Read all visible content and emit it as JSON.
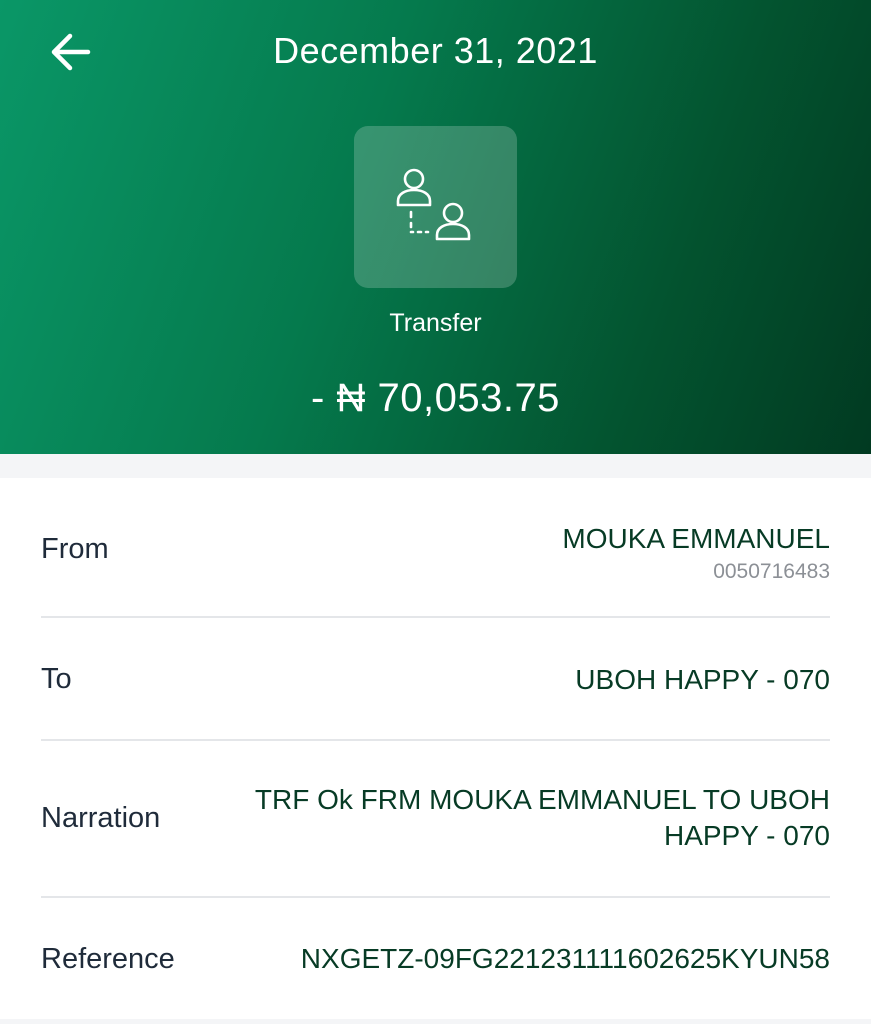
{
  "header": {
    "back_icon": "arrow-left-icon",
    "title": "December 31, 2021",
    "transaction_icon": "transfer-users-icon",
    "type_label": "Transfer",
    "amount": "- ₦ 70,053.75"
  },
  "details": {
    "from": {
      "label": "From",
      "name": "MOUKA EMMANUEL",
      "account": "0050716483"
    },
    "to": {
      "label": "To",
      "value": "UBOH HAPPY - 070"
    },
    "narration": {
      "label": "Narration",
      "line1": "TRF Ok FRM MOUKA EMMANUEL TO UBOH",
      "line2": "HAPPY - 070"
    },
    "reference": {
      "label": "Reference",
      "value": "NXGETZ-09FG221231111602625KYUN58"
    }
  },
  "colors": {
    "header_start": "#0a9767",
    "header_end": "#013a21",
    "value_text": "#073b25"
  }
}
